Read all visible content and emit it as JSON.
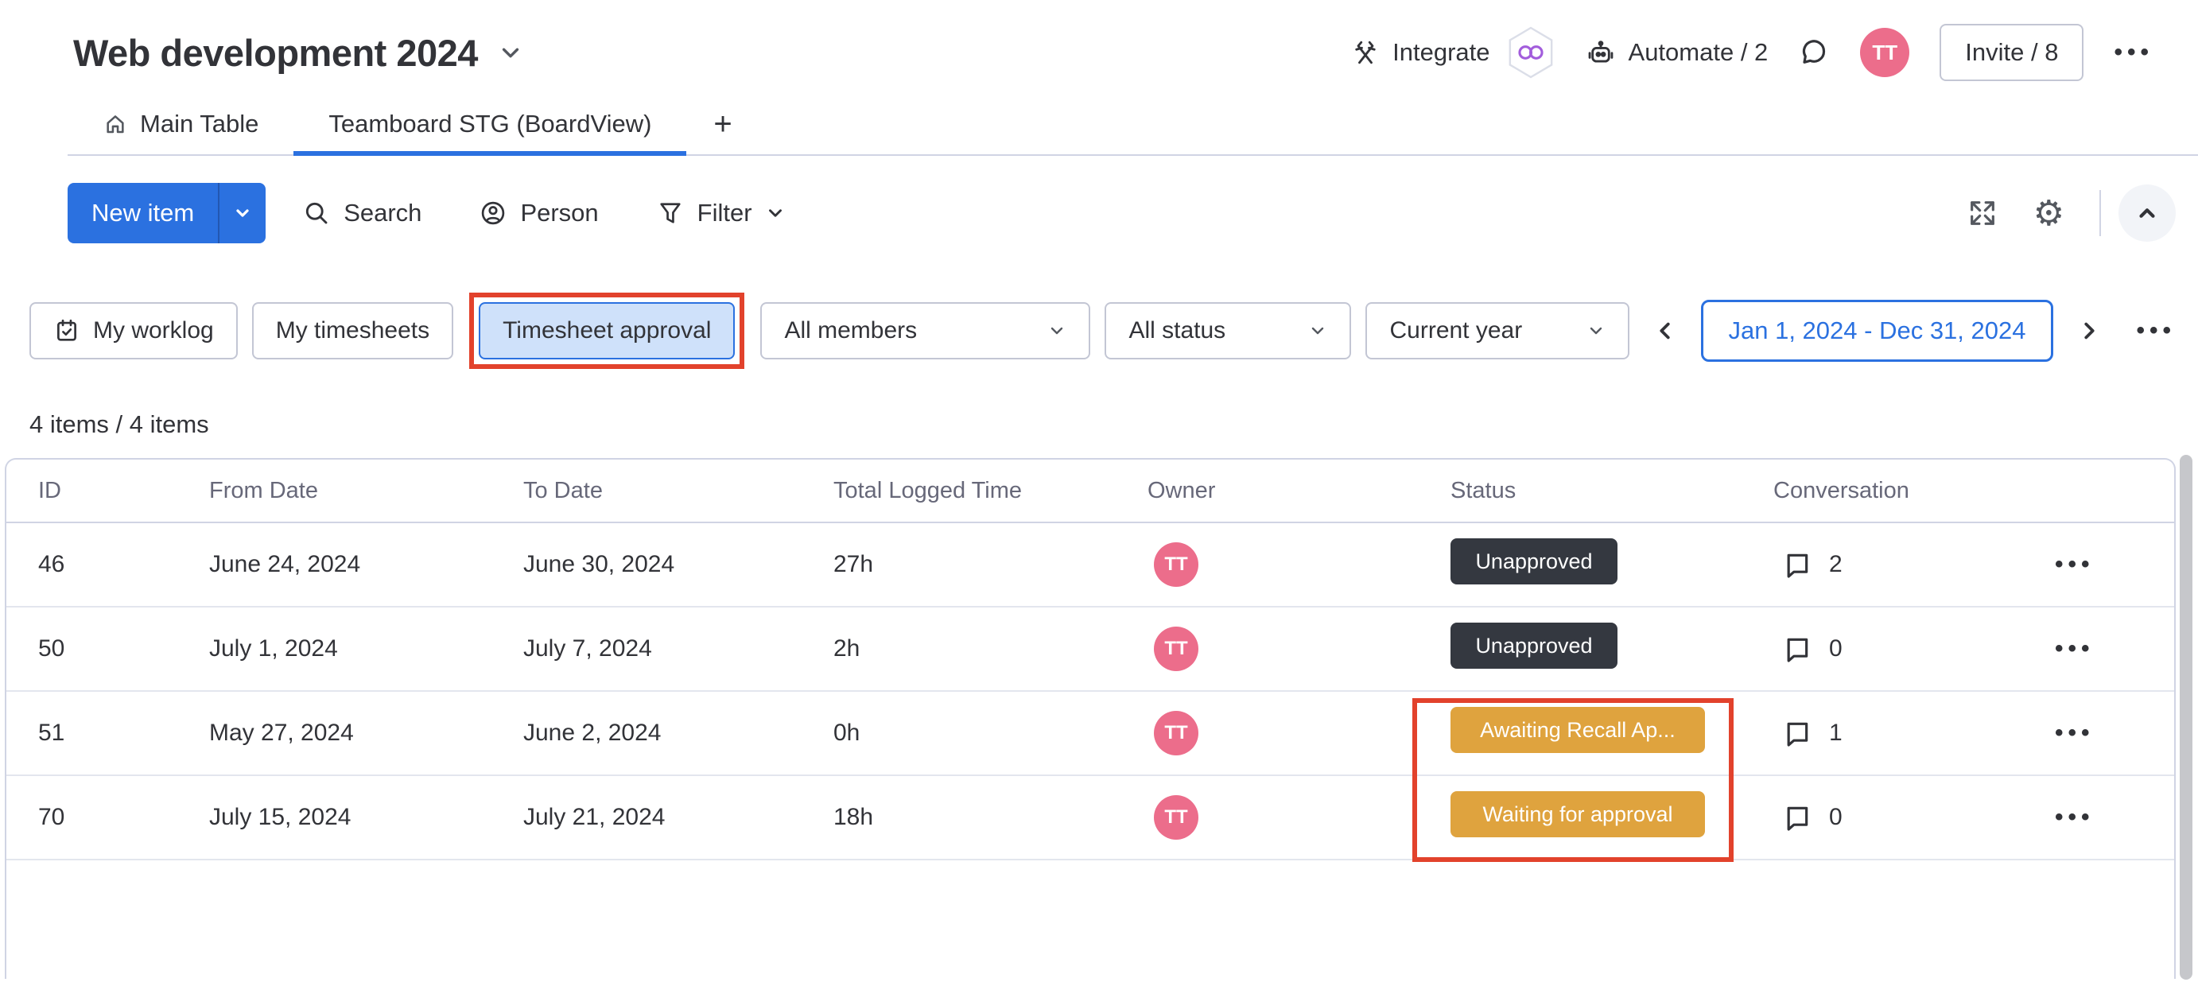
{
  "header": {
    "board_title": "Web development 2024",
    "integrate_label": "Integrate",
    "automate_label": "Automate / 2",
    "avatar_initials": "TT",
    "invite_label": "Invite / 8"
  },
  "tabs": {
    "main_table": "Main Table",
    "board_view": "Teamboard STG (BoardView)",
    "add_view": "+"
  },
  "toolbar": {
    "new_item_label": "New item",
    "search_label": "Search",
    "person_label": "Person",
    "filter_label": "Filter"
  },
  "filters": {
    "my_worklog": "My worklog",
    "my_timesheets": "My timesheets",
    "timesheet_approval": "Timesheet approval",
    "members_dropdown": "All members",
    "status_dropdown": "All status",
    "year_dropdown": "Current year",
    "date_range": "Jan 1, 2024 - Dec 31, 2024"
  },
  "items_count": "4 items / 4 items",
  "table": {
    "columns": [
      "ID",
      "From Date",
      "To Date",
      "Total Logged Time",
      "Owner",
      "Status",
      "Conversation"
    ],
    "rows": [
      {
        "id": "46",
        "from": "June 24, 2024",
        "to": "June 30, 2024",
        "time": "27h",
        "owner": "TT",
        "status": "Unapproved",
        "status_type": "dark",
        "conversations": "2"
      },
      {
        "id": "50",
        "from": "July 1, 2024",
        "to": "July 7, 2024",
        "time": "2h",
        "owner": "TT",
        "status": "Unapproved",
        "status_type": "dark",
        "conversations": "0"
      },
      {
        "id": "51",
        "from": "May 27, 2024",
        "to": "June 2, 2024",
        "time": "0h",
        "owner": "TT",
        "status": "Awaiting Recall Ap...",
        "status_type": "gold",
        "conversations": "1",
        "highlighted": true
      },
      {
        "id": "70",
        "from": "July 15, 2024",
        "to": "July 21, 2024",
        "time": "18h",
        "owner": "TT",
        "status": "Waiting for approval",
        "status_type": "gold",
        "conversations": "0",
        "highlighted": true
      }
    ]
  },
  "icons": {
    "dots": "•••",
    "gear": "⚙",
    "add": "+"
  },
  "colors": {
    "primary_blue": "#2b71e0",
    "selected_fill": "#cfe1fa",
    "dark_badge": "#343840",
    "gold_badge": "#dfa33e",
    "avatar_pink": "#ec6d8b",
    "highlight_red": "#e2422c",
    "integration_purple": "#a25ddc"
  }
}
